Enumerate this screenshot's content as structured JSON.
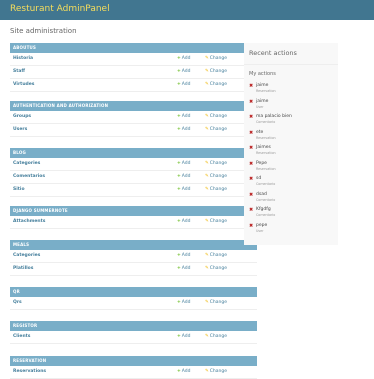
{
  "branding": "Resturant AdminPanel",
  "subtitle": "Site administration",
  "add_label": "Add",
  "change_label": "Change",
  "modules": [
    {
      "caption": "Aboutus",
      "models": [
        "Historia",
        "Staff",
        "Virtudes"
      ]
    },
    {
      "caption": "Authentication and Authorization",
      "models": [
        "Groups",
        "Users"
      ]
    },
    {
      "caption": "Blog",
      "models": [
        "Categories",
        "Comentarios",
        "Sitio"
      ]
    },
    {
      "caption": "Django Summernote",
      "models": [
        "Attachments"
      ]
    },
    {
      "caption": "Meals",
      "models": [
        "Categories",
        "Platillos"
      ]
    },
    {
      "caption": "QR",
      "models": [
        "Qrs"
      ]
    },
    {
      "caption": "Registor",
      "models": [
        "Clients"
      ]
    },
    {
      "caption": "Reservation",
      "models": [
        "Reservations"
      ]
    }
  ],
  "recent": {
    "title": "Recent actions",
    "subtitle": "My actions",
    "items": [
      {
        "name": "jaime",
        "type": "Reservation"
      },
      {
        "name": "jaime",
        "type": "User"
      },
      {
        "name": "ma palacio bien",
        "type": "Comentario"
      },
      {
        "name": "ete",
        "type": "Reservation"
      },
      {
        "name": "Jaimes",
        "type": "Reservation"
      },
      {
        "name": "Pepe",
        "type": "Reservation"
      },
      {
        "name": "sd",
        "type": "Comentario"
      },
      {
        "name": "dsad",
        "type": "Comentario"
      },
      {
        "name": "Kfgdfg",
        "type": "Comentario"
      },
      {
        "name": "pepe",
        "type": "User"
      }
    ]
  }
}
